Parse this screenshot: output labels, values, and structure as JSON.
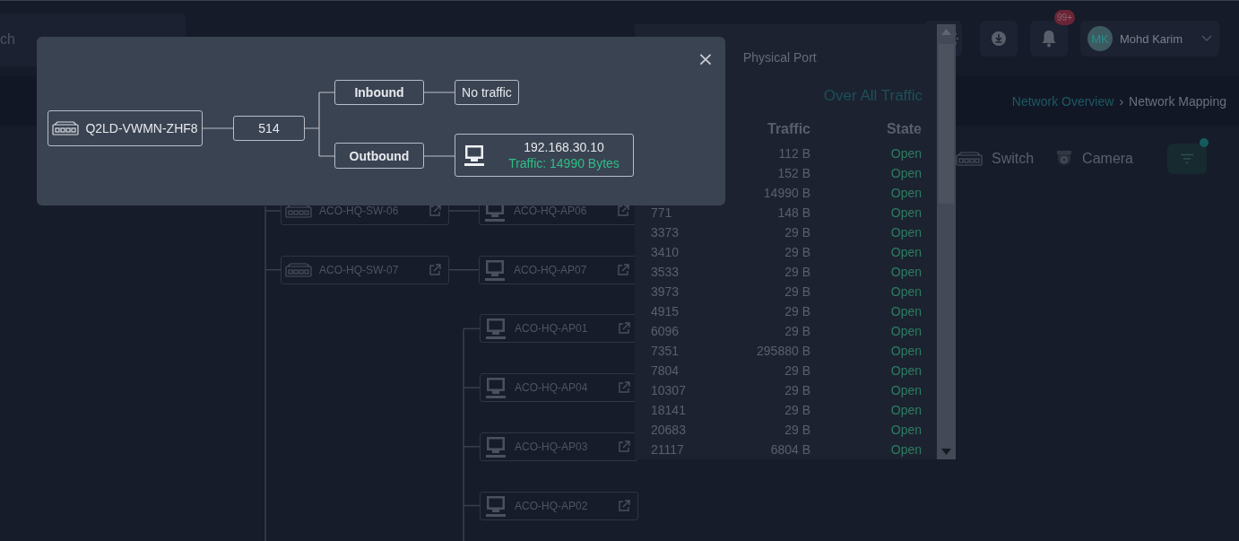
{
  "header": {
    "search": {
      "placeholder": "ch"
    },
    "notifications_badge": "99+",
    "user": {
      "initials": "MK",
      "name": "Mohd Karim"
    }
  },
  "breadcrumb": [
    {
      "label": "Network Overview",
      "link": true
    },
    {
      "label": "Network Mapping",
      "link": false
    }
  ],
  "breadcrumb_separator": "›",
  "legend": [
    {
      "kind": "switch",
      "label": "Switch"
    },
    {
      "kind": "camera",
      "label": "Camera"
    }
  ],
  "filter": {
    "active": true
  },
  "tree": [
    {
      "kind": "switch",
      "name": "ACO-HQ-SW-06",
      "children": [
        {
          "kind": "ap",
          "name": "ACO-HQ-AP06"
        }
      ]
    },
    {
      "kind": "switch",
      "name": "ACO-HQ-SW-07",
      "children": [
        {
          "kind": "ap",
          "name": "ACO-HQ-AP07"
        }
      ]
    }
  ],
  "tree_continued": [
    {
      "kind": "ap",
      "name": "ACO-HQ-AP01"
    },
    {
      "kind": "ap",
      "name": "ACO-HQ-AP04"
    },
    {
      "kind": "ap",
      "name": "ACO-HQ-AP03"
    },
    {
      "kind": "ap",
      "name": "ACO-HQ-AP02"
    }
  ],
  "port_panel": {
    "title": "Physical Port",
    "subtitle": "Over All Traffic",
    "columns": [
      "Traffic",
      "State"
    ],
    "rows": [
      {
        "traffic": "112 B",
        "state": "Open"
      },
      {
        "traffic": "152 B",
        "state": "Open"
      },
      {
        "traffic": "14990 B",
        "state": "Open"
      },
      {
        "port": "771",
        "traffic": "148 B",
        "state": "Open"
      },
      {
        "port": "3373",
        "traffic": "29 B",
        "state": "Open"
      },
      {
        "port": "3410",
        "traffic": "29 B",
        "state": "Open"
      },
      {
        "port": "3533",
        "traffic": "29 B",
        "state": "Open"
      },
      {
        "port": "3973",
        "traffic": "29 B",
        "state": "Open"
      },
      {
        "port": "4915",
        "traffic": "29 B",
        "state": "Open"
      },
      {
        "port": "6096",
        "traffic": "29 B",
        "state": "Open"
      },
      {
        "port": "7351",
        "traffic": "295880 B",
        "state": "Open"
      },
      {
        "port": "7804",
        "traffic": "29 B",
        "state": "Open"
      },
      {
        "port": "10307",
        "traffic": "29 B",
        "state": "Open"
      },
      {
        "port": "18141",
        "traffic": "29 B",
        "state": "Open"
      },
      {
        "port": "20683",
        "traffic": "29 B",
        "state": "Open"
      },
      {
        "port": "21117",
        "traffic": "6804 B",
        "state": "Open"
      }
    ]
  },
  "modal": {
    "close": "×",
    "device": "Q2LD-VWMN-ZHF8",
    "port": "514",
    "inbound": {
      "label": "Inbound",
      "target": "No traffic"
    },
    "outbound": {
      "label": "Outbound",
      "address": "192.168.30.10",
      "traffic": "Traffic: 14990 Bytes"
    }
  }
}
